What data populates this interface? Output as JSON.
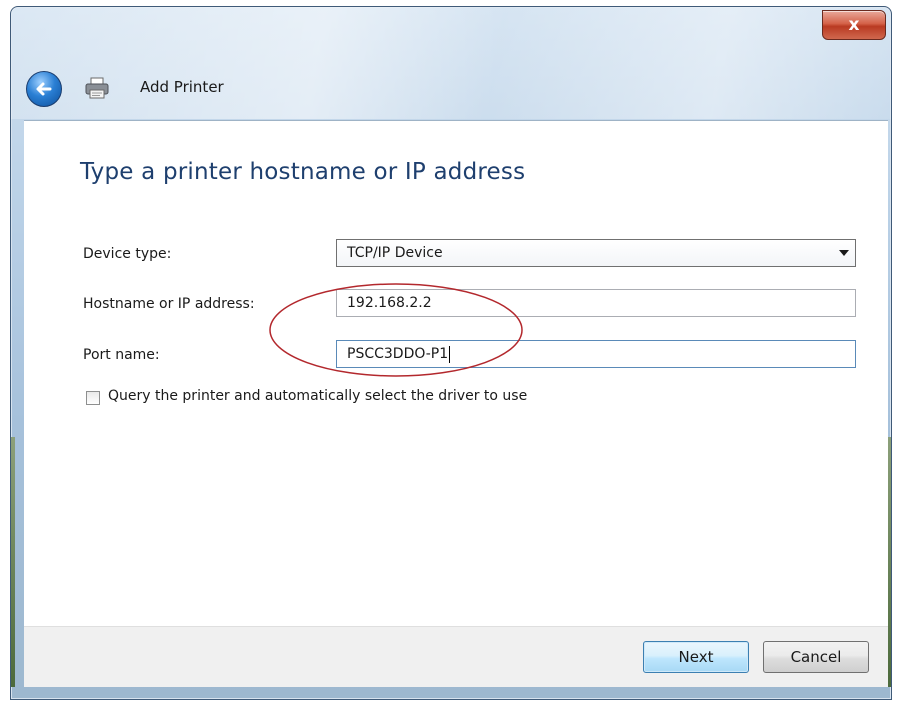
{
  "window": {
    "title": "Add Printer",
    "close_glyph": "x"
  },
  "icons": {
    "back": "back-arrow-icon",
    "printer": "printer-icon",
    "close": "close-icon",
    "dropdown": "chevron-down-icon"
  },
  "page": {
    "heading": "Type a printer hostname or IP address"
  },
  "form": {
    "device_type": {
      "label": "Device type:",
      "value": "TCP/IP Device"
    },
    "hostname": {
      "label": "Hostname or IP address:",
      "value": "192.168.2.2"
    },
    "port_name": {
      "label": "Port name:",
      "value": "PSCC3DDO-P1"
    },
    "query_checkbox": {
      "label": "Query the printer and automatically select the driver to use",
      "checked": false
    }
  },
  "buttons": {
    "next": "Next",
    "cancel": "Cancel"
  },
  "colors": {
    "heading": "#1e3f6e",
    "annotation_ellipse": "#b3282d",
    "default_button_border": "#3c7fb1"
  }
}
